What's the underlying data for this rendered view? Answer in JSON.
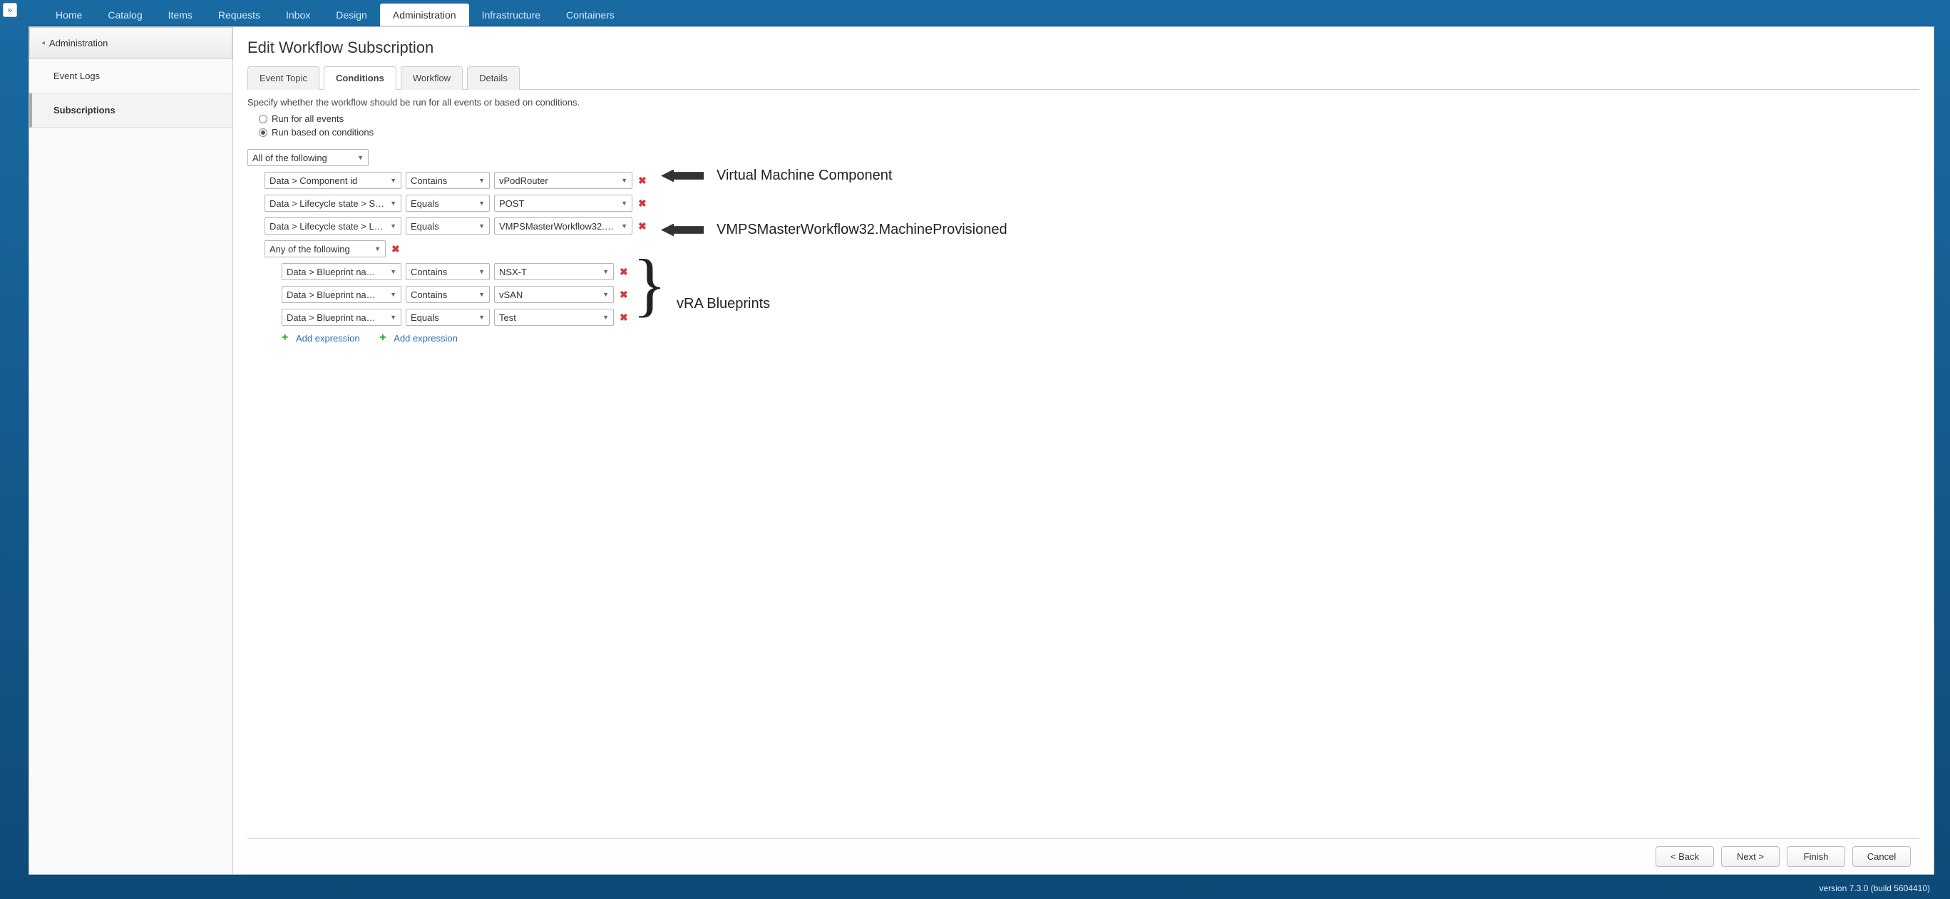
{
  "topNav": {
    "items": [
      "Home",
      "Catalog",
      "Items",
      "Requests",
      "Inbox",
      "Design",
      "Administration",
      "Infrastructure",
      "Containers"
    ],
    "activeIndex": 6
  },
  "sidebar": {
    "breadcrumb": "Administration",
    "items": [
      {
        "label": "Event Logs",
        "active": false
      },
      {
        "label": "Subscriptions",
        "active": true
      }
    ]
  },
  "page": {
    "title": "Edit Workflow Subscription"
  },
  "wizard": {
    "tabs": [
      "Event Topic",
      "Conditions",
      "Workflow",
      "Details"
    ],
    "activeIndex": 1,
    "hint": "Specify whether the workflow should be run for all events or based on conditions.",
    "radios": {
      "all": "Run for all events",
      "cond": "Run based on conditions",
      "selected": "cond"
    }
  },
  "conditions": {
    "rootGroup": "All of the following",
    "rows": [
      {
        "field": "Data > Component id",
        "op": "Contains",
        "value": "vPodRouter"
      },
      {
        "field": "Data > Lifecycle state > S…",
        "op": "Equals",
        "value": "POST"
      },
      {
        "field": "Data > Lifecycle state > L…",
        "op": "Equals",
        "value": "VMPSMasterWorkflow32.…"
      }
    ],
    "subGroup": {
      "label": "Any of the following",
      "rows": [
        {
          "field": "Data > Blueprint na…",
          "op": "Contains",
          "value": "NSX-T"
        },
        {
          "field": "Data > Blueprint na…",
          "op": "Contains",
          "value": "vSAN"
        },
        {
          "field": "Data > Blueprint na…",
          "op": "Equals",
          "value": "Test"
        }
      ],
      "addLabel": "Add expression"
    },
    "addLabel": "Add expression"
  },
  "annotations": {
    "a1": "Virtual Machine Component",
    "a2": "VMPSMasterWorkflow32.MachineProvisioned",
    "a3": "vRA Blueprints"
  },
  "footer": {
    "back": "< Back",
    "next": "Next >",
    "finish": "Finish",
    "cancel": "Cancel"
  },
  "version": "version 7.3.0 (build 5604410)"
}
